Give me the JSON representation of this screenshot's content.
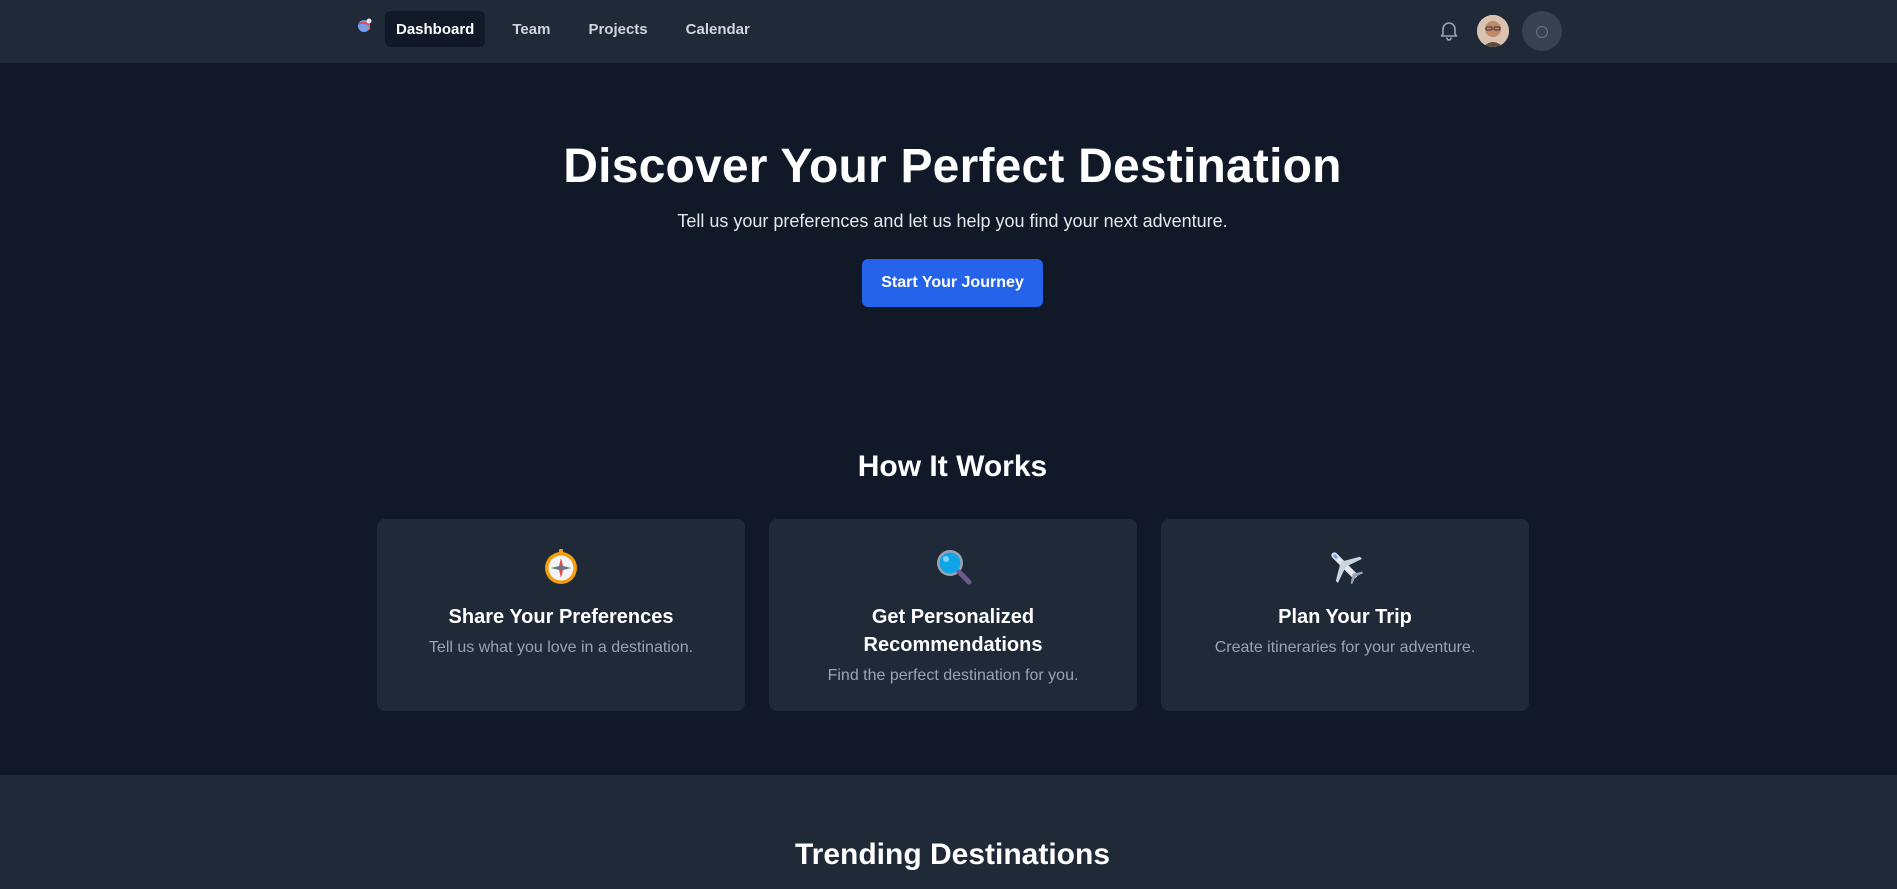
{
  "nav": {
    "logo_icon": "globe-logo-icon",
    "links": [
      {
        "label": "Dashboard",
        "active": true
      },
      {
        "label": "Team",
        "active": false
      },
      {
        "label": "Projects",
        "active": false
      },
      {
        "label": "Calendar",
        "active": false
      }
    ],
    "notification_icon": "bell-icon",
    "avatar_icon": "user-avatar",
    "theme_icon": "theme-toggle-icon"
  },
  "hero": {
    "title": "Discover Your Perfect Destination",
    "subtitle": "Tell us your preferences and let us help you find your next adventure.",
    "cta_label": "Start Your Journey"
  },
  "how_it_works": {
    "title": "How It Works",
    "steps": [
      {
        "icon": "compass-icon",
        "title": "Share Your Preferences",
        "description": "Tell us what you love in a destination."
      },
      {
        "icon": "magnifying-glass-icon",
        "title": "Get Personalized Recommendations",
        "description": "Find the perfect destination for you."
      },
      {
        "icon": "airplane-icon",
        "title": "Plan Your Trip",
        "description": "Create itineraries for your adventure."
      }
    ]
  },
  "trending": {
    "title": "Trending Destinations"
  },
  "colors": {
    "background": "#111827",
    "surface": "#1f2937",
    "accent": "#2563eb",
    "muted_text": "#9ca3af"
  }
}
